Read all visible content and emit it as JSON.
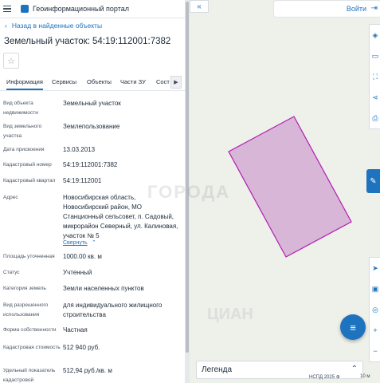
{
  "header": {
    "title": "Геоинформационный портал"
  },
  "nav": {
    "back_label": "Назад в найденные объекты"
  },
  "parcel": {
    "title": "Земельный участок: 54:19:112001:7382"
  },
  "tabs": [
    {
      "label": "Информация",
      "active": true
    },
    {
      "label": "Сервисы"
    },
    {
      "label": "Объекты"
    },
    {
      "label": "Части ЗУ"
    },
    {
      "label": "Сост"
    }
  ],
  "attributes": [
    {
      "label": "Вид объекта недвижимости",
      "value": "Земельный участок"
    },
    {
      "label": "Вид земельного участка",
      "value": "Землепользование"
    },
    {
      "label": "Дата присвоения",
      "value": "13.03.2013"
    },
    {
      "label": "Кадастровый номер",
      "value": "54:19:112001:7382"
    },
    {
      "label": "Кадастровый квартал",
      "value": "54:19:112001"
    },
    {
      "label": "Адрес",
      "value": "Новосибирская область, Новосибирский район, МО Станционный сельсовет, п. Садовый, микрорайон Северный, ул. Калиновая, участок № 5",
      "link": "Свернуть"
    },
    {
      "label": "Площадь уточненная",
      "value": "1000.00 кв. м"
    },
    {
      "label": "Статус",
      "value": "Учтенный"
    },
    {
      "label": "Категория земель",
      "value": "Земли населенных пунктов"
    },
    {
      "label": "Вид разрешенного использования",
      "value": "для индивидуального жилищного строительства"
    },
    {
      "label": "Форма собственности",
      "value": "Частная"
    },
    {
      "label": "Кадастровая стоимость",
      "value": "512 940 руб."
    },
    {
      "label": "Удельный показатель кадастровой",
      "value": "512,94 руб./кв. м"
    }
  ],
  "map": {
    "login_label": "Войти",
    "legend_label": "Легенда",
    "copyright": "НСПД 2025 ⊕",
    "scale": "10 м",
    "parcel_fill": "#d8b6d8",
    "parcel_stroke": "#b01cb0"
  },
  "watermarks": {
    "main": "ГОРОДА",
    "secondary": "ЦИАН"
  },
  "colors": {
    "accent": "#1e73be"
  }
}
